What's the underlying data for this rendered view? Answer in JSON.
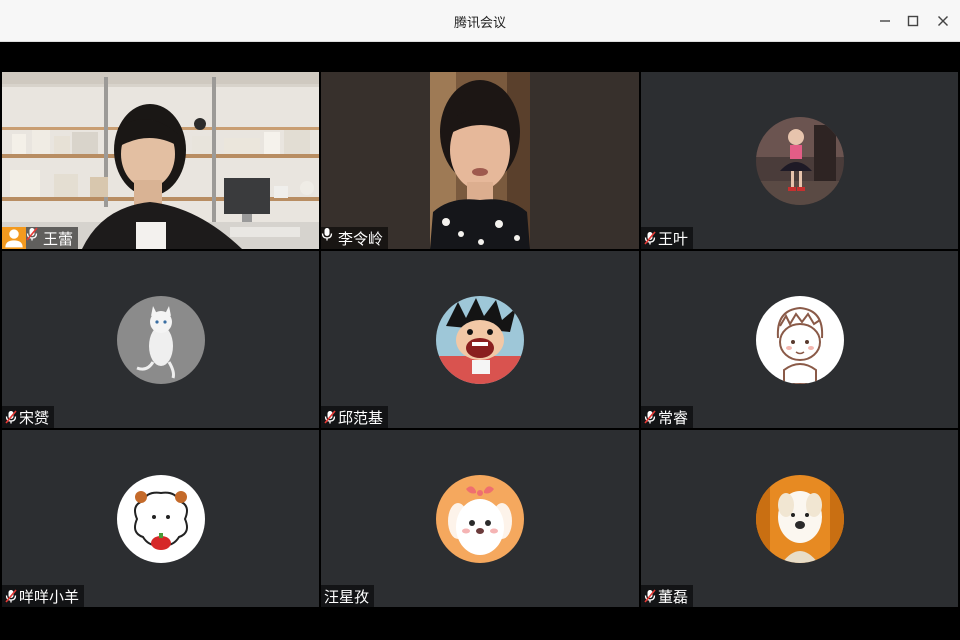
{
  "window": {
    "title": "腾讯会议"
  },
  "participants": [
    {
      "name": "王蕾",
      "muted": true,
      "video": true,
      "host": true
    },
    {
      "name": "李令岭",
      "muted": false,
      "video": true,
      "active_speaker": true
    },
    {
      "name": "王叶",
      "muted": true,
      "video": false
    },
    {
      "name": "宋赟",
      "muted": true,
      "video": false
    },
    {
      "name": "邱范基",
      "muted": true,
      "video": false
    },
    {
      "name": "常睿",
      "muted": true,
      "video": false
    },
    {
      "name": "咩咩小羊",
      "muted": true,
      "video": false
    },
    {
      "name": "汪星孜",
      "muted": false,
      "video": false
    },
    {
      "name": "董磊",
      "muted": true,
      "video": false
    }
  ],
  "colors": {
    "tile_bg": "#2c2e31",
    "active_border": "#2fc16b",
    "host_badge": "#f39a1f"
  }
}
